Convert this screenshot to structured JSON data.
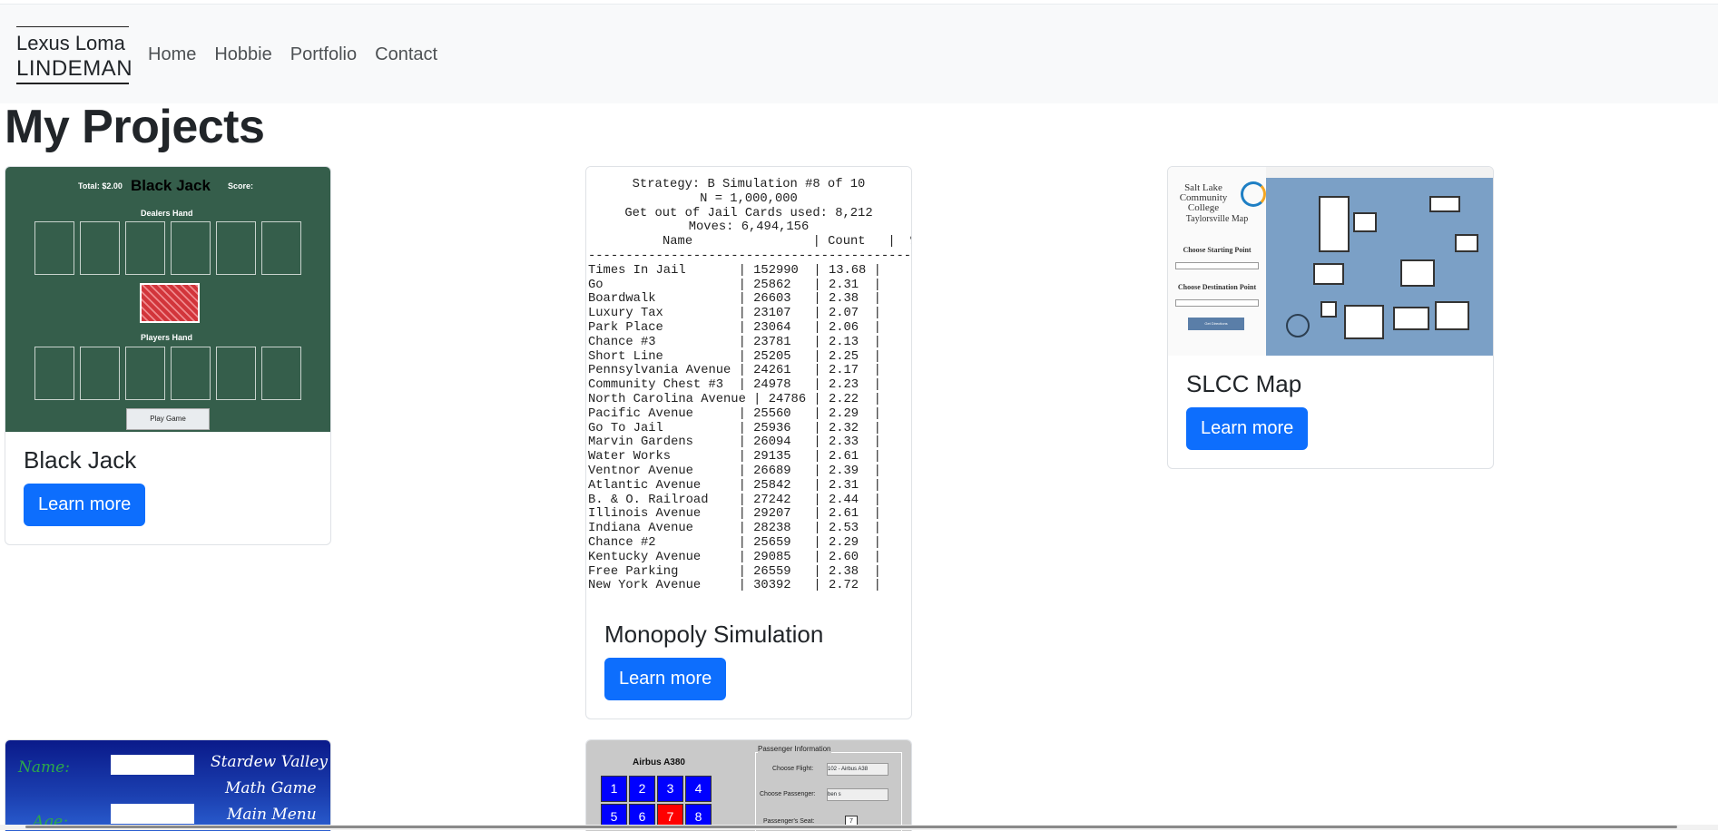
{
  "nav": {
    "brand_line1": "Lexus Loma",
    "brand_line2": "LINDEMAN",
    "links": [
      "Home",
      "Hobbie",
      "Portfolio",
      "Contact"
    ]
  },
  "page_title": "My Projects",
  "cards": [
    {
      "title": "Black Jack",
      "button": "Learn more",
      "thumb": {
        "total": "Total: $2.00",
        "game": "Black Jack",
        "score": "Score:",
        "dealers": "Dealers Hand",
        "players": "Players Hand",
        "play": "Play Game"
      }
    },
    {
      "title": "Monopoly Simulation",
      "button": "Learn more",
      "thumb": {
        "header": [
          "Strategy: B Simulation #8 of 10",
          "N = 1,000,000",
          "Get out of Jail Cards used: 8,212",
          "Moves: 6,494,156"
        ],
        "columns": "Name                | Count   |  %   |",
        "divider": "-----------------------------------------------",
        "rows": [
          "Times In Jail       | 152990  | 13.68 |",
          "Go                  | 25862   | 2.31  |",
          "Boardwalk           | 26603   | 2.38  |",
          "Luxury Tax          | 23107   | 2.07  |",
          "Park Place          | 23064   | 2.06  |",
          "Chance #3           | 23781   | 2.13  |",
          "Short Line          | 25205   | 2.25  |",
          "Pennsylvania Avenue | 24261   | 2.17  |",
          "Community Chest #3  | 24978   | 2.23  |",
          "North Carolina Avenue | 24786 | 2.22  |",
          "Pacific Avenue      | 25560   | 2.29  |",
          "Go To Jail          | 25936   | 2.32  |",
          "Marvin Gardens      | 26094   | 2.33  |",
          "Water Works         | 29135   | 2.61  |",
          "Ventnor Avenue      | 26689   | 2.39  |",
          "Atlantic Avenue     | 25842   | 2.31  |",
          "B. & O. Railroad    | 27242   | 2.44  |",
          "Illinois Avenue     | 29207   | 2.61  |",
          "Indiana Avenue      | 28238   | 2.53  |",
          "Chance #2           | 25659   | 2.29  |",
          "Kentucky Avenue     | 29085   | 2.60  |",
          "Free Parking        | 26559   | 2.38  |",
          "New York Avenue     | 30392   | 2.72  |"
        ]
      }
    },
    {
      "title": "SLCC Map",
      "button": "Learn more",
      "thumb": {
        "school1": "Salt Lake",
        "school2": "Community",
        "school3": "College",
        "school4": "Taylorsville Map",
        "start": "Choose Starting Point",
        "dest": "Choose Destination Point",
        "get": "Get Directions"
      }
    }
  ],
  "bottom": {
    "stardew": {
      "name": "Name:",
      "age": "Age:",
      "title1": "Stardew Valley",
      "title2": "Math Game",
      "title3": "Main Menu"
    },
    "airbus": {
      "plane": "Airbus A380",
      "panel": "Passenger Information",
      "flight_label": "Choose Flight:",
      "flight_value": "102 - Airbus A38",
      "passenger_label": "Choose Passenger:",
      "passenger_value": "ben s",
      "seat_label": "Passenger's Seat:",
      "seat_value": "7",
      "seats": [
        "1",
        "2",
        "3",
        "4",
        "5",
        "6",
        "7",
        "8"
      ]
    }
  }
}
